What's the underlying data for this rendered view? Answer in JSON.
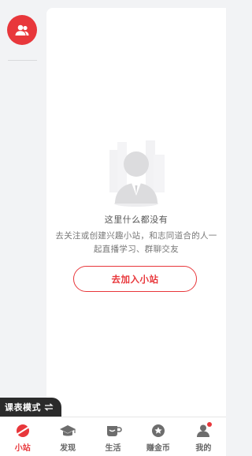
{
  "empty_state": {
    "title": "这里什么都没有",
    "desc_line1": "去关注或创建兴趣小站，和志同道合的人一",
    "desc_line2": "起直播学习、群聊交友",
    "join_label": "去加入小站"
  },
  "mode_toggle": {
    "label": "课表模式",
    "icon": "swap-icon"
  },
  "tabs": [
    {
      "label": "小站",
      "icon": "station-icon",
      "active": true
    },
    {
      "label": "发现",
      "icon": "graduation-cap-icon",
      "active": false
    },
    {
      "label": "生活",
      "icon": "cup-icon",
      "active": false
    },
    {
      "label": "赚金币",
      "icon": "coin-star-icon",
      "active": false
    },
    {
      "label": "我的",
      "icon": "user-icon",
      "active": false,
      "badge": true
    }
  ],
  "colors": {
    "accent": "#e8373b",
    "background": "#f2f3f5",
    "card": "#ffffff",
    "toggle_bg": "#2b2b2b"
  }
}
